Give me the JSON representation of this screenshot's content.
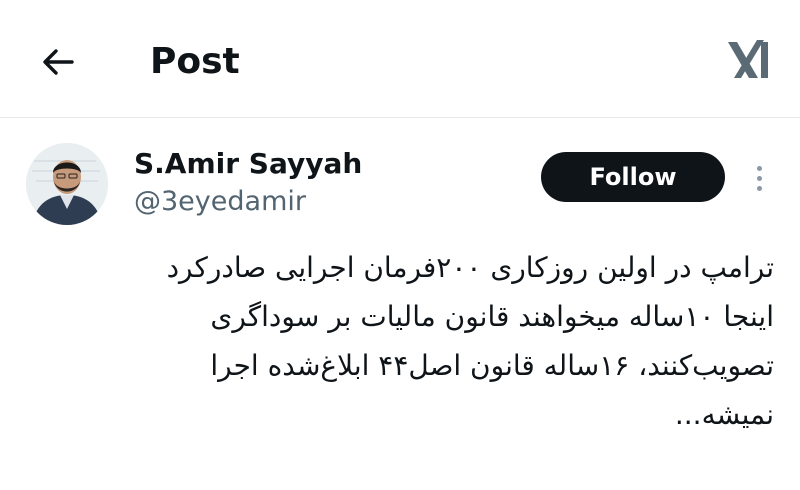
{
  "header": {
    "title": "Post",
    "back_icon": "arrow-left-icon",
    "logo_icon": "x-logo-icon"
  },
  "author": {
    "name": "S.Amir Sayyah",
    "handle": "@3eyedamir",
    "avatar_icon": "avatar-photo"
  },
  "actions": {
    "follow_label": "Follow",
    "more_icon": "more-vertical-icon"
  },
  "tweet": {
    "lines": [
      "ترامپ در اولین روزکاری ۲۰۰فرمان اجرایی صادرکرد",
      "اینجا ۱۰ساله میخواهند قانون مالیات بر سوداگری",
      "تصویب‌کنند، ۱۶ساله قانون اصل۴۴ ابلاغ‌شده اجرا",
      "نمیشه..."
    ]
  },
  "colors": {
    "text": "#0f1419",
    "secondary": "#536471",
    "follow_bg": "#0f1419",
    "divider": "#e6e9ea",
    "link": "#1d9bf0"
  }
}
